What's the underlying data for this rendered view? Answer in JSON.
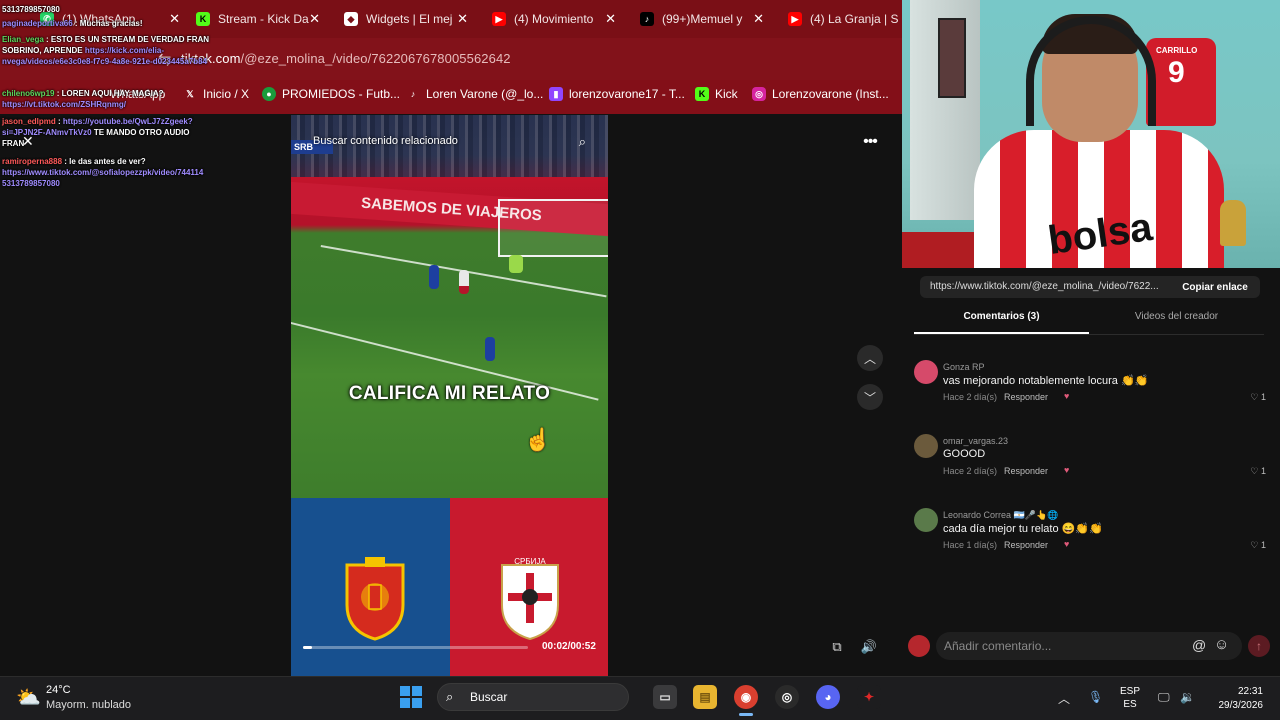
{
  "browser": {
    "tabs": [
      {
        "label": "(1) WhatsApp",
        "icon": "whatsapp-icon",
        "color": "#25d366"
      },
      {
        "label": "Stream - Kick Da",
        "icon": "kick-icon",
        "color": "#53fc18"
      },
      {
        "label": "Widgets | El mej",
        "icon": "widgets-icon",
        "color": "#ffffff"
      },
      {
        "label": "(4) Movimiento",
        "icon": "youtube-icon",
        "color": "#ff0000"
      },
      {
        "label": "(99+)Memuel y",
        "icon": "tiktok-icon",
        "color": "#000000"
      },
      {
        "label": "(4) La Granja | S",
        "icon": "youtube-icon",
        "color": "#ff0000"
      }
    ],
    "url_domain": "tiktok.com",
    "url_path": "/@eze_molina_/video/7622067678005562642",
    "bookmarks": [
      {
        "label": "WhatsApp",
        "icon": "whatsapp-icon"
      },
      {
        "label": "Inicio / X",
        "icon": "x-icon"
      },
      {
        "label": "PROMIEDOS - Futb...",
        "icon": "promiedos-icon"
      },
      {
        "label": "Loren Varone (@_lo...",
        "icon": "tiktok-icon"
      },
      {
        "label": "lorenzovarone17 - T...",
        "icon": "twitch-icon"
      },
      {
        "label": "Kick",
        "icon": "kick-icon"
      },
      {
        "label": "Lorenzovarone (Inst...",
        "icon": "instagram-icon"
      }
    ]
  },
  "chat_overlay": [
    {
      "user": "",
      "text": "5313789857080"
    },
    {
      "user": "paginadeportiva66",
      "text": ": Muchas gracias!"
    },
    {
      "user": "Elian_vega",
      "text": ": ESTO ES UN STREAM DE VERDAD FRAN SOBRINO, APRENDE",
      "link": "https://kick.com/elia-nvega/videos/e6e3c0e8-f7c9-4a8e-921e-d023445a7b84"
    },
    {
      "user": "chileno6wp19",
      "text": ": LOREN AQUI HAY MAGIA?",
      "link": "https://vt.tiktok.com/ZSHRqnmg/"
    },
    {
      "user": "jason_edlpmd",
      "link": "https://youtube.be/QwLJ7zZgeek?si=JPJN2F-ANmvTkVz0",
      "text": "TE MANDO OTRO AUDIO FRAN"
    },
    {
      "user": "ramiroperna888",
      "text": ": le das antes de ver?",
      "link": "https://www.tiktok.com/@sofialopezzpk/video/744114 5313789857080"
    }
  ],
  "video": {
    "search_placeholder": "Buscar contenido relacionado",
    "team_badge": "SRB",
    "banner_text": "SABEMOS DE VIAJEROS",
    "caption": "CALIFICA MI RELATO",
    "time": "00:02/00:52",
    "progress": 0.04,
    "left_color": "#17508f",
    "right_color": "#c81a2e"
  },
  "webcam": {
    "jersey_name": "CARRILLO",
    "jersey_number": "9",
    "shirt_text": "bolsa"
  },
  "panel": {
    "share_url": "https://www.tiktok.com/@eze_molina_/video/7622...",
    "copy_label": "Copiar enlace",
    "tab_comments": "Comentarios (3)",
    "tab_videos": "Videos del creador",
    "reply_label": "Responder",
    "comments": [
      {
        "user": "Gonza RP",
        "text": "vas mejorando notablemente locura 👏👏",
        "time": "Hace 2 día(s)",
        "likes": "1",
        "avatar_color": "#d64a6a"
      },
      {
        "user": "omar_vargas.23",
        "text": "GOOOD",
        "time": "Hace 2 día(s)",
        "likes": "1",
        "avatar_color": "#6b5a3c"
      },
      {
        "user": "Leonardo Correa 🇦🇷🎤👆🌐",
        "text": "cada día mejor tu relato 😄👏👏",
        "time": "Hace 1 día(s)",
        "likes": "1",
        "avatar_color": "#5a7a4a"
      }
    ],
    "add_comment_placeholder": "Añadir comentario..."
  },
  "taskbar": {
    "temp": "24°C",
    "weather": "Mayorm. nublado",
    "search_label": "Buscar",
    "lang_line1": "ESP",
    "lang_line2": "ES",
    "time": "22:31",
    "date": "29/3/2026"
  }
}
